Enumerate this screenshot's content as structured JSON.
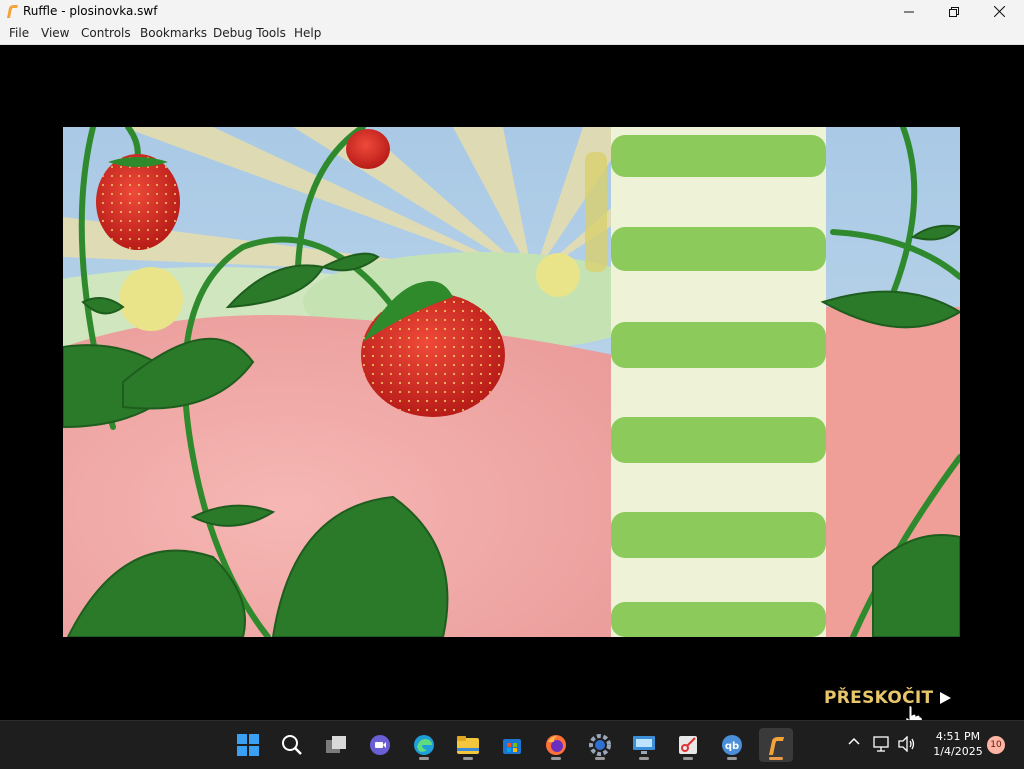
{
  "window": {
    "title": "Ruffle - plosinovka.swf",
    "controls": [
      "minimize",
      "maximize",
      "close"
    ]
  },
  "menu": {
    "items": [
      "File",
      "View",
      "Controls",
      "Bookmarks",
      "Debug Tools",
      "Help"
    ]
  },
  "content": {
    "skip_label": "PŘESKOČIT",
    "skip_icon": "play-triangle-icon"
  },
  "taskbar": {
    "apps": [
      "windows-start-icon",
      "search-icon",
      "task-view-icon",
      "chat-icon",
      "edge-icon",
      "file-explorer-icon",
      "store-icon",
      "firefox-icon",
      "settings-icon",
      "remote-desktop-icon",
      "snipping-tool-icon",
      "qbittorrent-icon",
      "ruffle-icon"
    ],
    "active_app": "ruffle-icon",
    "tray_icons": [
      "chevron-up-icon",
      "network-icon",
      "volume-icon"
    ],
    "time": "4:51 PM",
    "date": "1/4/2025",
    "notification_count": "10"
  },
  "colors": {
    "skip_text": "#e8c76a",
    "ruffle_accent": "#e89a4a",
    "taskbar_bg": "#1e1e1e"
  }
}
